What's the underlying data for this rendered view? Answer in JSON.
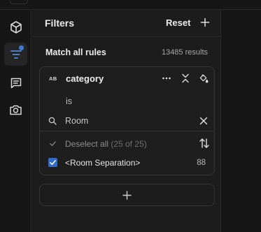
{
  "rail": {
    "items": [
      {
        "icon": "cube-icon",
        "active": false
      },
      {
        "icon": "filter-icon",
        "active": true,
        "has_notification": true
      },
      {
        "icon": "list-document-icon",
        "active": false
      },
      {
        "icon": "camera-icon",
        "active": false
      }
    ],
    "accent_color": "#3d7bd9"
  },
  "panel": {
    "title": "Filters",
    "reset_label": "Reset",
    "match_label": "Match all rules",
    "results_text": "13485 results"
  },
  "rule": {
    "type_badge": "AB",
    "field_name": "category",
    "operator": "is",
    "search": {
      "value": "Room",
      "placeholder": "Search"
    },
    "deselect_label": "Deselect all",
    "deselect_count": "(25 of 25)",
    "options": [
      {
        "label": "<Room Separation>",
        "count": "88",
        "checked": true
      }
    ]
  },
  "colors": {
    "checkbox": "#2f6dc7",
    "panel_bg": "#1c1c1c"
  }
}
